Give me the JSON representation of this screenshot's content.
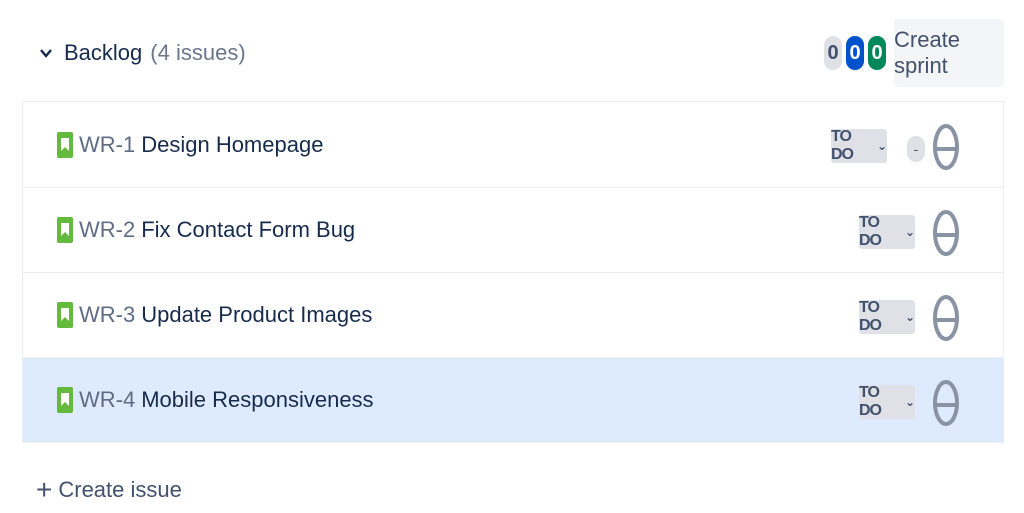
{
  "backlog": {
    "title": "Backlog",
    "count_label": "(4 issues)",
    "counts": [
      "0",
      "0",
      "0"
    ],
    "create_sprint_label": "Create sprint"
  },
  "issues": [
    {
      "key": "WR-1",
      "summary": "Design Homepage",
      "status": "TO DO",
      "estimate": "-"
    },
    {
      "key": "WR-2",
      "summary": "Fix Contact Form Bug",
      "status": "TO DO"
    },
    {
      "key": "WR-3",
      "summary": "Update Product Images",
      "status": "TO DO"
    },
    {
      "key": "WR-4",
      "summary": "Mobile Responsiveness",
      "status": "TO DO"
    }
  ],
  "create_issue_label": "Create issue",
  "colors": {
    "story_green": "#63ba3c",
    "selected_row": "#deebff",
    "pill_blue": "#0052cc",
    "pill_green": "#00875a"
  }
}
